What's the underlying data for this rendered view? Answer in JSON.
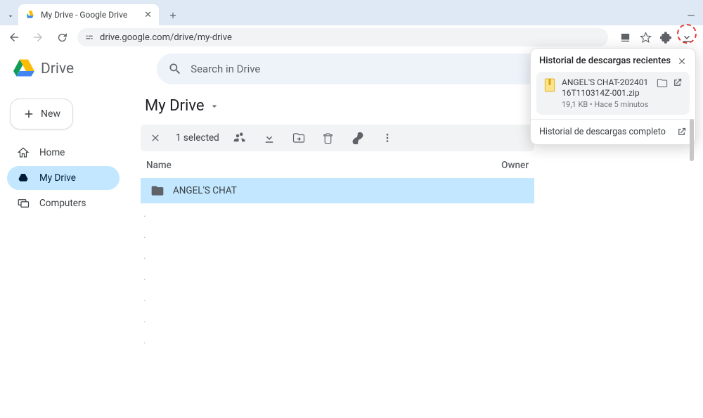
{
  "chrome": {
    "tab_title": "My Drive - Google Drive",
    "url": "drive.google.com/drive/my-drive"
  },
  "downloads_popover": {
    "title": "Historial de descargas recientes",
    "item": {
      "name": "ANGEL'S CHAT-20240116T110314Z-001.zip",
      "meta": "19,1 KB • Hace 5 minutos"
    },
    "footer": "Historial de descargas completo"
  },
  "drive": {
    "brand": "Drive",
    "search_placeholder": "Search in Drive",
    "new_button": "New",
    "sidebar": {
      "home": "Home",
      "my_drive": "My Drive",
      "computers": "Computers"
    },
    "page_title": "My Drive",
    "toolbar": {
      "selected_text": "1 selected"
    },
    "columns": {
      "name": "Name",
      "owner": "Owner"
    },
    "file_row": {
      "name": "ANGEL'S CHAT"
    }
  }
}
